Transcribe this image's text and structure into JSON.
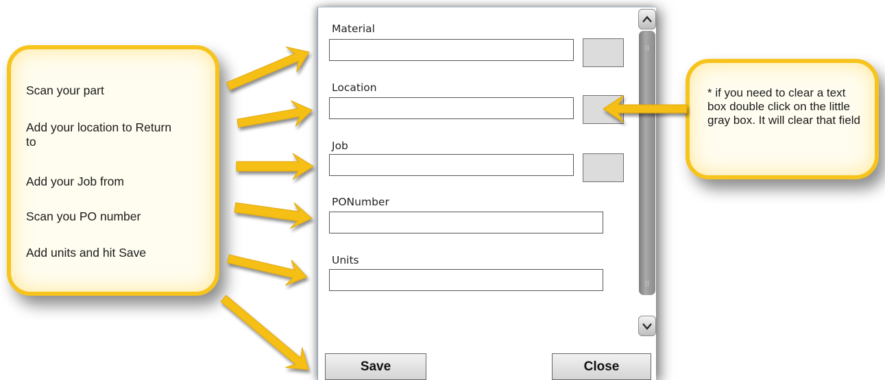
{
  "instructions": {
    "steps": [
      "Scan your part",
      "Add your location to Return to",
      "Add your Job from",
      "Scan you PO number",
      "Add units and hit Save"
    ],
    "clear_note": "* if you need to clear a text box double click on the little gray box. It will clear that field"
  },
  "form": {
    "fields": [
      {
        "label": "Material",
        "value": ""
      },
      {
        "label": "Location",
        "value": ""
      },
      {
        "label": "Job",
        "value": ""
      },
      {
        "label": "PONumber",
        "value": ""
      },
      {
        "label": "Units",
        "value": ""
      }
    ],
    "buttons": {
      "save": "Save",
      "close": "Close"
    }
  },
  "colors": {
    "callout_border": "#f7c31d",
    "arrow": "#f5bf18",
    "callout_fill": "#fffdf0"
  },
  "icons": {
    "scroll_up": "chevron-up-icon",
    "scroll_down": "chevron-down-icon"
  }
}
